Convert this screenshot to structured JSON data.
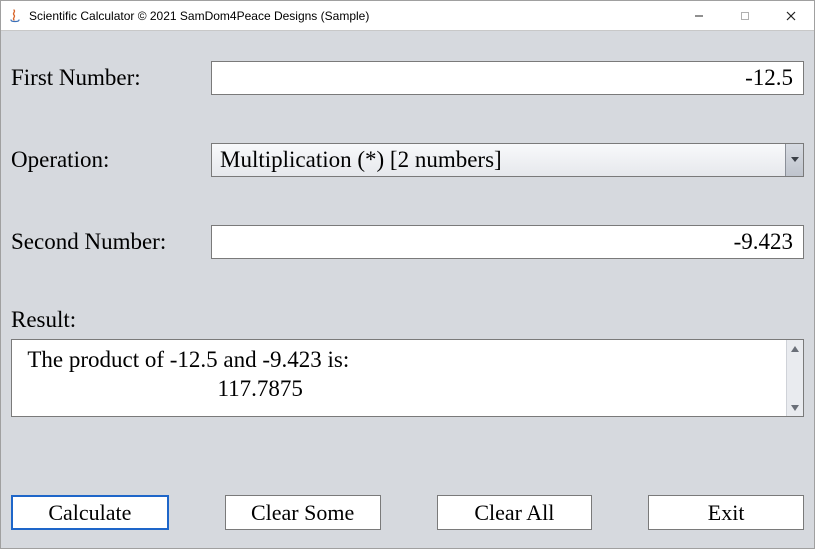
{
  "window": {
    "title": "Scientific Calculator © 2021 SamDom4Peace Designs (Sample)"
  },
  "labels": {
    "first_number": "First Number:",
    "operation": "Operation:",
    "second_number": "Second Number:",
    "result": "Result:"
  },
  "inputs": {
    "first_number_value": "-12.5",
    "second_number_value": "-9.423"
  },
  "operation": {
    "selected": "Multiplication (*) [2 numbers]"
  },
  "result": {
    "text": " The product of -12.5 and -9.423 is:\n                                  117.7875"
  },
  "buttons": {
    "calculate": "Calculate",
    "clear_some": "Clear Some",
    "clear_all": "Clear All",
    "exit": "Exit"
  }
}
